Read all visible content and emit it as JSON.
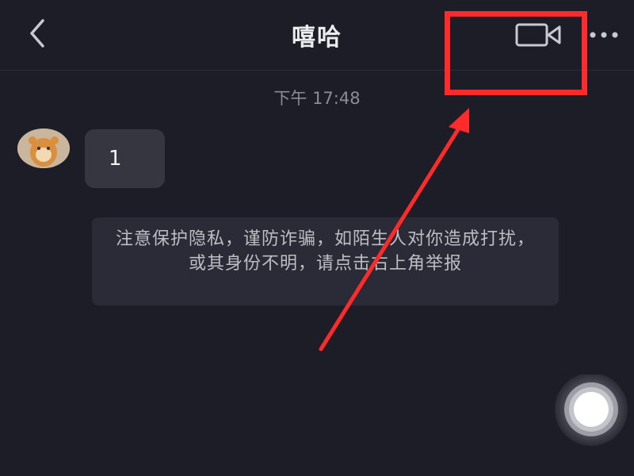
{
  "header": {
    "title": "嘻哈",
    "back_icon": "chevron-left-icon",
    "video_call_icon": "video-camera-icon",
    "more_icon": "more-horizontal-icon"
  },
  "chat": {
    "timestamp": "下午 17:48",
    "messages": [
      {
        "sender": "other",
        "text": "1"
      }
    ],
    "notice": "注意保护隐私，谨防诈骗，如陌生人对你造成打扰，或其身份不明，请点击右上角举报"
  },
  "annotation": {
    "color": "#ff2b2b"
  },
  "colors": {
    "background": "#1c1d27",
    "bubble": "#35363f",
    "notice_bg": "#2a2b36"
  }
}
